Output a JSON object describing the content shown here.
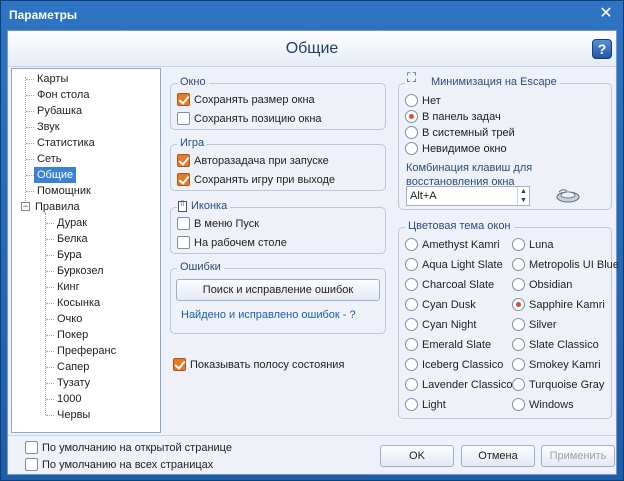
{
  "window": {
    "title": "Параметры",
    "close_glyph": "✕"
  },
  "header": {
    "title": "Общие",
    "help_glyph": "?"
  },
  "tree": {
    "items": [
      {
        "label": "Карты"
      },
      {
        "label": "Фон стола"
      },
      {
        "label": "Рубашка"
      },
      {
        "label": "Звук"
      },
      {
        "label": "Статистика"
      },
      {
        "label": "Сеть"
      },
      {
        "label": "Общие",
        "selected": true
      },
      {
        "label": "Помощник"
      },
      {
        "label": "Правила",
        "expanded": true,
        "expander": "−"
      }
    ],
    "children": [
      {
        "label": "Дурак"
      },
      {
        "label": "Белка"
      },
      {
        "label": "Бура"
      },
      {
        "label": "Буркозел"
      },
      {
        "label": "Кинг"
      },
      {
        "label": "Косынка"
      },
      {
        "label": "Очко"
      },
      {
        "label": "Покер"
      },
      {
        "label": "Преферанс"
      },
      {
        "label": "Сапер"
      },
      {
        "label": "Тузату"
      },
      {
        "label": "1000"
      },
      {
        "label": "Червы"
      }
    ]
  },
  "groups": {
    "window": {
      "title": "Окно",
      "items": [
        {
          "label": "Сохранять размер окна",
          "checked": true
        },
        {
          "label": "Сохранять позицию окна",
          "checked": false
        }
      ]
    },
    "game": {
      "title": "Игра",
      "items": [
        {
          "label": "Авторазадача при запуске",
          "checked": true
        },
        {
          "label": "Сохранять игру при выходе",
          "checked": true
        }
      ]
    },
    "icon": {
      "title": "Иконка",
      "items": [
        {
          "label": "В меню Пуск",
          "checked": false
        },
        {
          "label": "На рабочем столе",
          "checked": false
        }
      ]
    },
    "errors": {
      "title": "Ошибки",
      "button": "Поиск и исправление ошибок",
      "status": "Найдено и исправлено ошибок - ?"
    },
    "status_bar": {
      "label": "Показывать полосу состояния",
      "checked": true
    },
    "minimize": {
      "title": "Минимизация на Escape",
      "options": [
        {
          "label": "Нет",
          "selected": false
        },
        {
          "label": "В панель задач",
          "selected": true
        },
        {
          "label": "В системный трей",
          "selected": false
        },
        {
          "label": "Невидимое окно",
          "selected": false
        }
      ],
      "hotkey_label": "Комбинация клавиш для восстановления окна",
      "hotkey_value": "Alt+A"
    },
    "theme": {
      "title": "Цветовая тема окон",
      "left": [
        {
          "label": "Amethyst Kamri",
          "selected": false
        },
        {
          "label": "Aqua Light Slate",
          "selected": false
        },
        {
          "label": "Charcoal Slate",
          "selected": false
        },
        {
          "label": "Cyan Dusk",
          "selected": false
        },
        {
          "label": "Cyan Night",
          "selected": false
        },
        {
          "label": "Emerald Slate",
          "selected": false
        },
        {
          "label": "Iceberg Classico",
          "selected": false
        },
        {
          "label": "Lavender Classico",
          "selected": false
        },
        {
          "label": "Light",
          "selected": false
        }
      ],
      "right": [
        {
          "label": "Luna",
          "selected": false
        },
        {
          "label": "Metropolis UI Blue",
          "selected": false
        },
        {
          "label": "Obsidian",
          "selected": false
        },
        {
          "label": "Sapphire Kamri",
          "selected": true
        },
        {
          "label": "Silver",
          "selected": false
        },
        {
          "label": "Slate Classico",
          "selected": false
        },
        {
          "label": "Smokey Kamri",
          "selected": false
        },
        {
          "label": "Turquoise Gray",
          "selected": false
        },
        {
          "label": "Windows",
          "selected": false
        }
      ]
    }
  },
  "footer": {
    "default_open": {
      "label": "По умолчанию на открытой странице",
      "checked": false
    },
    "default_all": {
      "label": "По умолчанию на всех страницах",
      "checked": false
    },
    "ok": "OK",
    "cancel": "Отмена",
    "apply": "Применить"
  },
  "colors": {
    "accent": "#e47a2b",
    "selection": "#3a82d8",
    "title_bar": "#2f74c2"
  }
}
